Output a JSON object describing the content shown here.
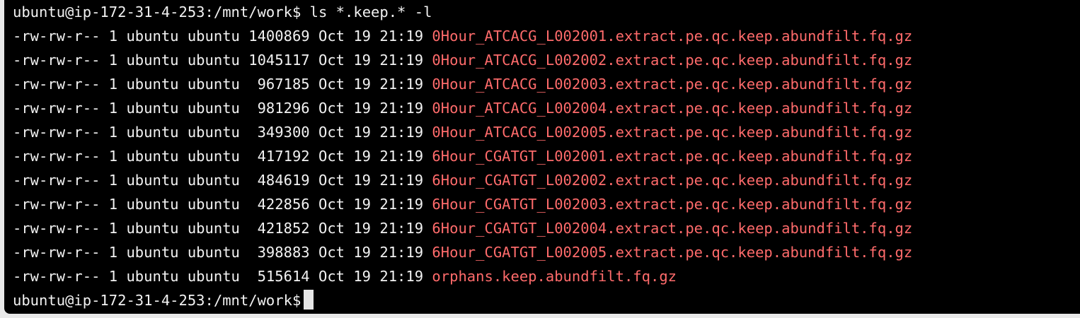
{
  "terminal": {
    "prompt": "ubuntu@ip-172-31-4-253:/mnt/work$",
    "command": " ls *.keep.* -l",
    "listing": [
      {
        "meta": "-rw-rw-r-- 1 ubuntu ubuntu 1400869 Oct 19 21:19 ",
        "file": "0Hour_ATCACG_L002001.extract.pe.qc.keep.abundfilt.fq.gz"
      },
      {
        "meta": "-rw-rw-r-- 1 ubuntu ubuntu 1045117 Oct 19 21:19 ",
        "file": "0Hour_ATCACG_L002002.extract.pe.qc.keep.abundfilt.fq.gz"
      },
      {
        "meta": "-rw-rw-r-- 1 ubuntu ubuntu  967185 Oct 19 21:19 ",
        "file": "0Hour_ATCACG_L002003.extract.pe.qc.keep.abundfilt.fq.gz"
      },
      {
        "meta": "-rw-rw-r-- 1 ubuntu ubuntu  981296 Oct 19 21:19 ",
        "file": "0Hour_ATCACG_L002004.extract.pe.qc.keep.abundfilt.fq.gz"
      },
      {
        "meta": "-rw-rw-r-- 1 ubuntu ubuntu  349300 Oct 19 21:19 ",
        "file": "0Hour_ATCACG_L002005.extract.pe.qc.keep.abundfilt.fq.gz"
      },
      {
        "meta": "-rw-rw-r-- 1 ubuntu ubuntu  417192 Oct 19 21:19 ",
        "file": "6Hour_CGATGT_L002001.extract.pe.qc.keep.abundfilt.fq.gz"
      },
      {
        "meta": "-rw-rw-r-- 1 ubuntu ubuntu  484619 Oct 19 21:19 ",
        "file": "6Hour_CGATGT_L002002.extract.pe.qc.keep.abundfilt.fq.gz"
      },
      {
        "meta": "-rw-rw-r-- 1 ubuntu ubuntu  422856 Oct 19 21:19 ",
        "file": "6Hour_CGATGT_L002003.extract.pe.qc.keep.abundfilt.fq.gz"
      },
      {
        "meta": "-rw-rw-r-- 1 ubuntu ubuntu  421852 Oct 19 21:19 ",
        "file": "6Hour_CGATGT_L002004.extract.pe.qc.keep.abundfilt.fq.gz"
      },
      {
        "meta": "-rw-rw-r-- 1 ubuntu ubuntu  398883 Oct 19 21:19 ",
        "file": "6Hour_CGATGT_L002005.extract.pe.qc.keep.abundfilt.fq.gz"
      },
      {
        "meta": "-rw-rw-r-- 1 ubuntu ubuntu  515614 Oct 19 21:19 ",
        "file": "orphans.keep.abundfilt.fq.gz"
      }
    ],
    "final_prompt": "ubuntu@ip-172-31-4-253:/mnt/work$",
    "colors": {
      "background": "#000000",
      "text": "#f2f2f2",
      "filename": "#ff6b6b",
      "cursor": "#e6e6e6"
    }
  }
}
